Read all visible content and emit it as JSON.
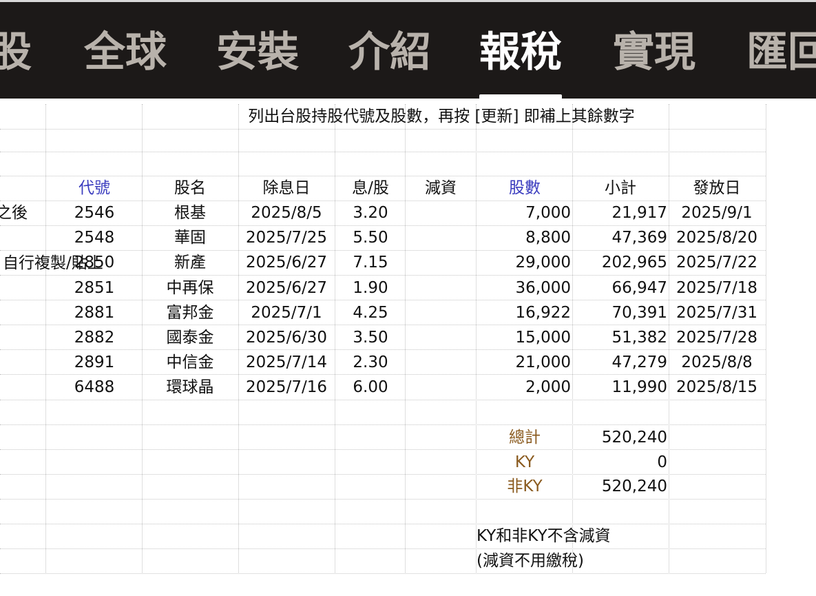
{
  "tabs": [
    {
      "label": "股",
      "active": false
    },
    {
      "label": "全球",
      "active": false
    },
    {
      "label": "安裝",
      "active": false
    },
    {
      "label": "介紹",
      "active": false
    },
    {
      "label": "報稅",
      "active": true
    },
    {
      "label": "實現",
      "active": false
    },
    {
      "label": "匯回",
      "active": false
    }
  ],
  "sheet": {
    "instruction": "列出台股持股代號及股數，再按 [更新] 即補上其餘數字",
    "side_labels": {
      "after": "之後",
      "copy": "自行複製/貼上"
    },
    "headers": {
      "code": "代號",
      "name": "股名",
      "ex_date": "除息日",
      "dividend": "息/股",
      "capital_reduction": "減資",
      "shares": "股數",
      "subtotal": "小計",
      "pay_date": "發放日"
    },
    "rows": [
      {
        "code": "2546",
        "name": "根基",
        "ex_date": "2025/8/5",
        "dividend": "3.20",
        "shares": "7,000",
        "subtotal": "21,917",
        "pay_date": "2025/9/1"
      },
      {
        "code": "2548",
        "name": "華固",
        "ex_date": "2025/7/25",
        "dividend": "5.50",
        "shares": "8,800",
        "subtotal": "47,369",
        "pay_date": "2025/8/20"
      },
      {
        "code": "2850",
        "name": "新產",
        "ex_date": "2025/6/27",
        "dividend": "7.15",
        "shares": "29,000",
        "subtotal": "202,965",
        "pay_date": "2025/7/22"
      },
      {
        "code": "2851",
        "name": "中再保",
        "ex_date": "2025/6/27",
        "dividend": "1.90",
        "shares": "36,000",
        "subtotal": "66,947",
        "pay_date": "2025/7/18"
      },
      {
        "code": "2881",
        "name": "富邦金",
        "ex_date": "2025/7/1",
        "dividend": "4.25",
        "shares": "16,922",
        "subtotal": "70,391",
        "pay_date": "2025/7/31"
      },
      {
        "code": "2882",
        "name": "國泰金",
        "ex_date": "2025/6/30",
        "dividend": "3.50",
        "shares": "15,000",
        "subtotal": "51,382",
        "pay_date": "2025/7/28"
      },
      {
        "code": "2891",
        "name": "中信金",
        "ex_date": "2025/7/14",
        "dividend": "2.30",
        "shares": "21,000",
        "subtotal": "47,279",
        "pay_date": "2025/8/8"
      },
      {
        "code": "6488",
        "name": "環球晶",
        "ex_date": "2025/7/16",
        "dividend": "6.00",
        "shares": "2,000",
        "subtotal": "11,990",
        "pay_date": "2025/8/15"
      }
    ],
    "totals": [
      {
        "label": "總計",
        "value": "520,240"
      },
      {
        "label": "KY",
        "value": "0"
      },
      {
        "label": "非KY",
        "value": "520,240"
      }
    ],
    "notes": [
      "KY和非KY不含減資",
      "(減資不用繳稅)"
    ]
  },
  "colors": {
    "header_blue": "#3b3dbf",
    "label_brown": "#8a5a1e",
    "topbar": "#1c1918"
  }
}
